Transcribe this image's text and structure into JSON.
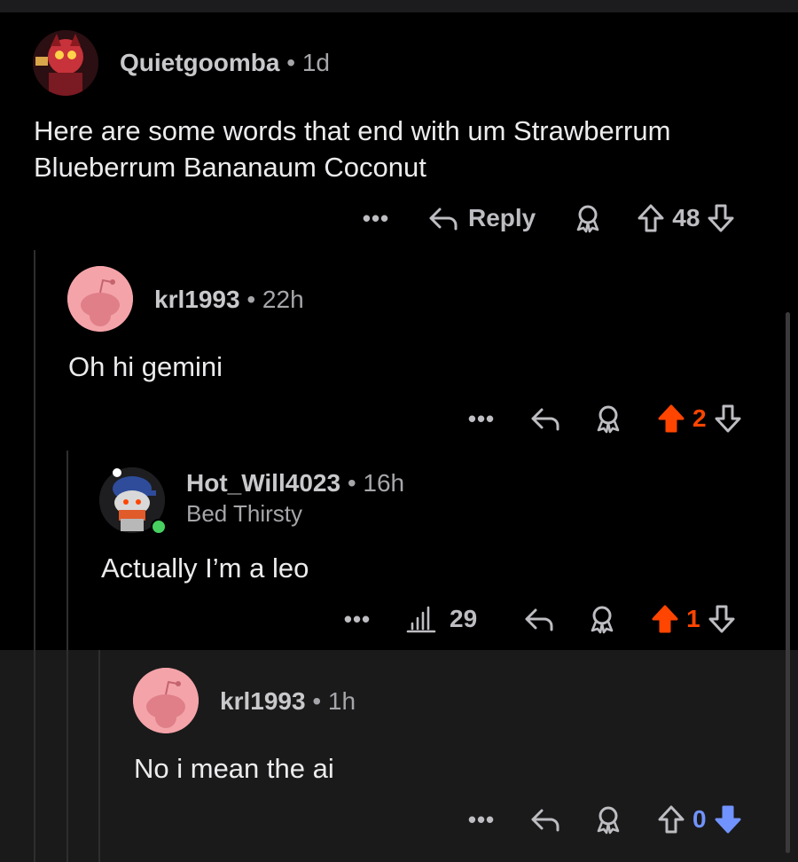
{
  "colors": {
    "upvote_active": "#ff4500",
    "downvote_active": "#7193ff",
    "text": "#ececee",
    "muted": "#a6a6aa"
  },
  "comments": [
    {
      "username": "Quietgoomba",
      "age": "1d",
      "body": "Here are some words that end with um Strawberrum Blueberrum Bananaum Coconut",
      "more_label": "•••",
      "reply_label": "Reply",
      "score": "48",
      "vote": "none"
    },
    {
      "username": "krl1993",
      "age": "22h",
      "body": "Oh hi gemini",
      "more_label": "•••",
      "score": "2",
      "vote": "up"
    },
    {
      "username": "Hot_Will4023",
      "age": "16h",
      "flair": "Bed Thirsty",
      "body": "Actually I’m a leo",
      "more_label": "•••",
      "views": "29",
      "score": "1",
      "vote": "up"
    },
    {
      "username": "krl1993",
      "age": "1h",
      "body": "No i mean the ai",
      "more_label": "•••",
      "score": "0",
      "vote": "down"
    }
  ],
  "separator": "•"
}
